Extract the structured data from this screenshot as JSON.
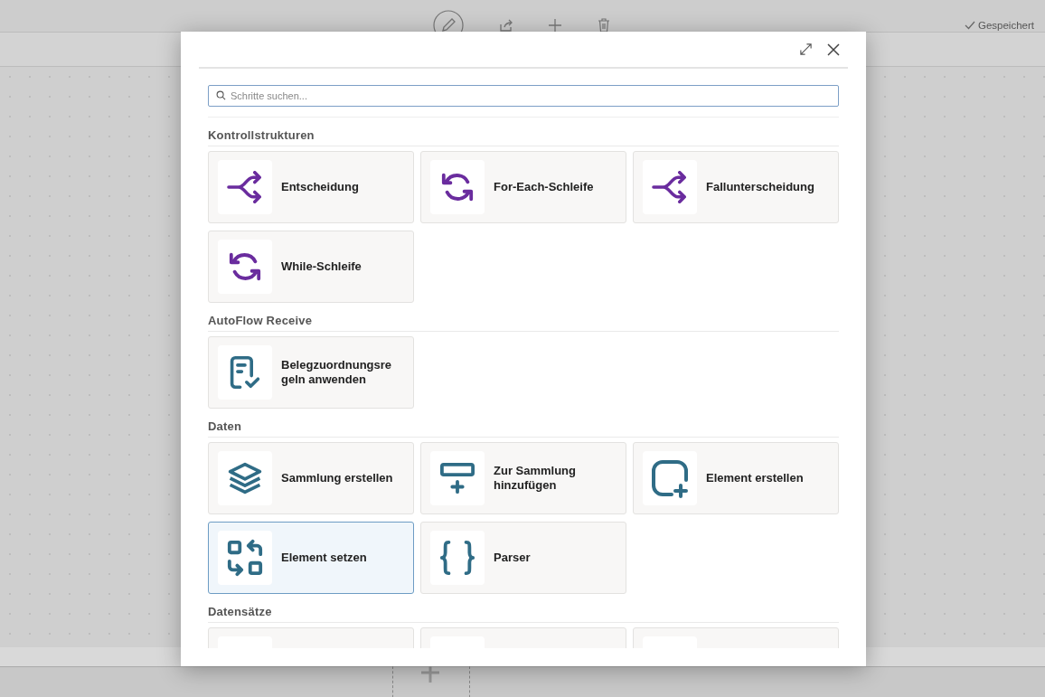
{
  "toolbar": {
    "tools": [
      {
        "kind": "edit"
      },
      {
        "kind": "share"
      },
      {
        "kind": "add"
      },
      {
        "kind": "delete"
      }
    ],
    "status": "Gespeichert"
  },
  "dialog": {
    "search": {
      "placeholder": "Schritte suchen..."
    },
    "sections": [
      {
        "title": "Kontrollstrukturen",
        "items": [
          {
            "label": "Entscheidung",
            "kind": "branch",
            "selected": false
          },
          {
            "label": "For-Each-Schleife",
            "kind": "loop",
            "selected": false
          },
          {
            "label": "Fallunterscheidung",
            "kind": "branch",
            "selected": false
          },
          {
            "label": "While-Schleife",
            "kind": "loop",
            "selected": false
          }
        ]
      },
      {
        "title": "AutoFlow Receive",
        "items": [
          {
            "label": "Belegzuordnungsre geln anwenden",
            "kind": "document-check",
            "selected": false
          }
        ]
      },
      {
        "title": "Daten",
        "items": [
          {
            "label": "Sammlung erstellen",
            "kind": "layers",
            "selected": false
          },
          {
            "label": "Zur Sammlung hinzufügen",
            "kind": "add-row",
            "selected": false
          },
          {
            "label": "Element erstellen",
            "kind": "add-square",
            "selected": false
          },
          {
            "label": "Element setzen",
            "kind": "swap",
            "selected": true
          },
          {
            "label": "Parser",
            "kind": "braces",
            "selected": false
          }
        ]
      },
      {
        "title": "Datensätze",
        "items": [
          {
            "selected": false
          },
          {
            "selected": false
          },
          {
            "selected": false
          }
        ]
      }
    ]
  }
}
